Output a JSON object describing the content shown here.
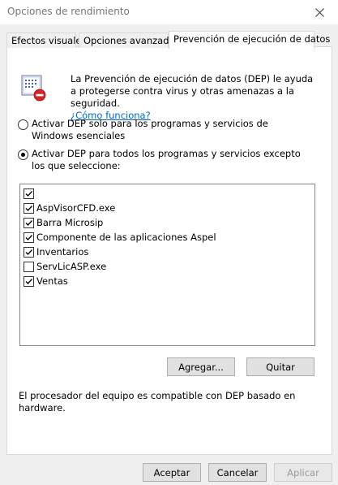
{
  "window": {
    "title": "Opciones de rendimiento"
  },
  "tabs": [
    {
      "label": "Efectos visuales",
      "active": false
    },
    {
      "label": "Opciones avanzadas",
      "active": false
    },
    {
      "label": "Prevención de ejecución de datos",
      "active": true
    }
  ],
  "intro": {
    "text": "La Prevención de ejecución de datos (DEP) le ayuda a protegerse contra virus y otras amenazas a la seguridad.",
    "link": "¿Cómo funciona?"
  },
  "options": [
    {
      "label": "Activar DEP solo para los programas y servicios de Windows esenciales",
      "selected": false
    },
    {
      "label": "Activar DEP para todos los programas y servicios excepto los que seleccione:",
      "selected": true
    }
  ],
  "exceptions": [
    {
      "label": "",
      "checked": true
    },
    {
      "label": "AspVisorCFD.exe",
      "checked": true
    },
    {
      "label": "Barra Microsip",
      "checked": true
    },
    {
      "label": "Componente de las aplicaciones Aspel",
      "checked": true
    },
    {
      "label": "Inventarios",
      "checked": true
    },
    {
      "label": "ServLicASP.exe",
      "checked": false
    },
    {
      "label": "Ventas",
      "checked": true
    }
  ],
  "list_buttons": {
    "add": "Agregar...",
    "remove": "Quitar"
  },
  "note": "El procesador del equipo es compatible con DEP basado en hardware.",
  "dialog_buttons": {
    "ok": "Aceptar",
    "cancel": "Cancelar",
    "apply": "Aplicar",
    "apply_enabled": false
  },
  "icons": {
    "close": "close-icon",
    "dep": "dep-shield-icon",
    "check": "check-icon"
  },
  "colors": {
    "link": "#0066cc",
    "dialog_bg": "#f0f0f0",
    "button_bg": "#e1e1e1"
  }
}
